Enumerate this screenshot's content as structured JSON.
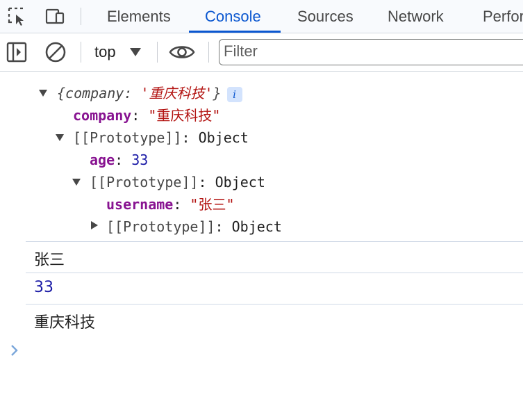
{
  "tabs": [
    {
      "label": "Elements",
      "active": false
    },
    {
      "label": "Console",
      "active": true
    },
    {
      "label": "Sources",
      "active": false
    },
    {
      "label": "Network",
      "active": false
    },
    {
      "label": "Perfor",
      "active": false
    }
  ],
  "toolbar": {
    "context": "top",
    "filter_placeholder": "Filter"
  },
  "object_tree": {
    "summary_open": "{",
    "summary_key": "company",
    "summary_colon": ": ",
    "summary_value": "'重庆科技'",
    "summary_close": "}",
    "info_badge": "i",
    "props": [
      {
        "key": "company",
        "colon": ": ",
        "value": "\"重庆科技\""
      }
    ],
    "proto1": {
      "label": "[[Prototype]]",
      "colon": ": ",
      "type": "Object"
    },
    "proto1_props": [
      {
        "key": "age",
        "colon": ": ",
        "value": "33"
      }
    ],
    "proto2": {
      "label": "[[Prototype]]",
      "colon": ": ",
      "type": "Object"
    },
    "proto2_props": [
      {
        "key": "username",
        "colon": ": ",
        "value": "\"张三\""
      }
    ],
    "proto3": {
      "label": "[[Prototype]]",
      "colon": ": ",
      "type": "Object"
    }
  },
  "logs": [
    {
      "text": "张三",
      "kind": "string"
    },
    {
      "text": "33",
      "kind": "number"
    },
    {
      "text": "重庆科技",
      "kind": "string"
    }
  ],
  "colors": {
    "accent": "#0b57d0",
    "key": "#881391",
    "string": "#b31412",
    "number": "#1a1aa6",
    "prompt": "#7aa6da"
  },
  "icons": {
    "inspect": "inspect-element-icon",
    "device": "device-toolbar-icon",
    "sidebar": "show-sidebar-icon",
    "clear": "clear-console-icon",
    "eye": "live-expression-icon",
    "prompt": "console-prompt-icon"
  }
}
